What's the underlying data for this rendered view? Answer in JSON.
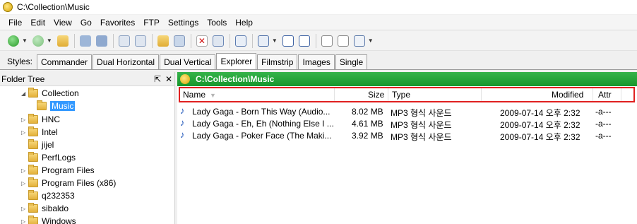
{
  "window": {
    "title": "C:\\Collection\\Music"
  },
  "menu": [
    "File",
    "Edit",
    "View",
    "Go",
    "Favorites",
    "FTP",
    "Settings",
    "Tools",
    "Help"
  ],
  "styles": {
    "label": "Styles:",
    "tabs": [
      "Commander",
      "Dual Horizontal",
      "Dual Vertical",
      "Explorer",
      "Filmstrip",
      "Images",
      "Single"
    ],
    "active": "Explorer"
  },
  "folder_tree": {
    "title": "Folder Tree",
    "items": [
      {
        "label": "Collection",
        "expanded": true
      },
      {
        "label": "Music",
        "selected": true
      },
      {
        "label": "HNC"
      },
      {
        "label": "Intel"
      },
      {
        "label": "jijel"
      },
      {
        "label": "PerfLogs"
      },
      {
        "label": "Program Files"
      },
      {
        "label": "Program Files (x86)"
      },
      {
        "label": "q232353"
      },
      {
        "label": "sibaldo"
      },
      {
        "label": "Windows"
      }
    ]
  },
  "path_bar": {
    "path": "C:\\Collection\\Music"
  },
  "columns": {
    "name": "Name",
    "size": "Size",
    "type": "Type",
    "modified": "Modified",
    "attr": "Attr"
  },
  "files": [
    {
      "name": "Lady Gaga - Born This Way (Audio...",
      "size": "8.02 MB",
      "type": "MP3 형식 사운드",
      "modified": "2009-07-14 오후 2:32",
      "attr": "-a---"
    },
    {
      "name": "Lady Gaga - Eh, Eh (Nothing Else I ...",
      "size": "4.61 MB",
      "type": "MP3 형식 사운드",
      "modified": "2009-07-14 오후 2:32",
      "attr": "-a---"
    },
    {
      "name": "Lady Gaga - Poker Face (The Maki...",
      "size": "3.92 MB",
      "type": "MP3 형식 사운드",
      "modified": "2009-07-14 오후 2:32",
      "attr": "-a---"
    }
  ],
  "colors": {
    "path_bar": "#1aa130",
    "selection": "#3399ff",
    "highlight_border": "#e02020"
  }
}
